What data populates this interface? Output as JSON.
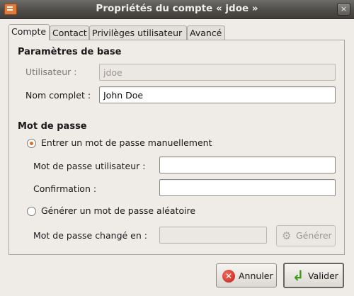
{
  "window": {
    "title": "Propriétés du compte « jdoe »",
    "close_glyph": "×"
  },
  "tabs": [
    {
      "label": "Compte",
      "active": true
    },
    {
      "label": "Contact",
      "active": false
    },
    {
      "label": "Privilèges utilisateur",
      "active": false
    },
    {
      "label": "Avancé",
      "active": false
    }
  ],
  "basic": {
    "title": "Paramètres de base",
    "user_label": "Utilisateur :",
    "user_value": "jdoe",
    "fullname_label": "Nom complet :",
    "fullname_value": "John Doe"
  },
  "password": {
    "title": "Mot de passe",
    "manual_option": "Entrer un mot de passe manuellement",
    "user_pw_label": "Mot de passe utilisateur :",
    "user_pw_value": "",
    "confirm_label": "Confirmation :",
    "confirm_value": "",
    "random_option": "Générer un mot de passe aléatoire",
    "changed_label": "Mot de passe changé en :",
    "changed_value": "",
    "generate_label": "Générer",
    "selected": "manual"
  },
  "buttons": {
    "cancel": "Annuler",
    "ok": "Valider"
  },
  "colors": {
    "titlebar": "#4f4d4a",
    "window_bg": "#efebe7",
    "radio_dot": "#e07020",
    "cancel_icon": "#c0201a",
    "ok_icon": "#3f9a1a"
  },
  "icons": {
    "app": "app-window-icon",
    "close": "close-icon",
    "generate": "gear-icon",
    "cancel": "cancel-icon",
    "ok": "green-arrow-icon"
  }
}
